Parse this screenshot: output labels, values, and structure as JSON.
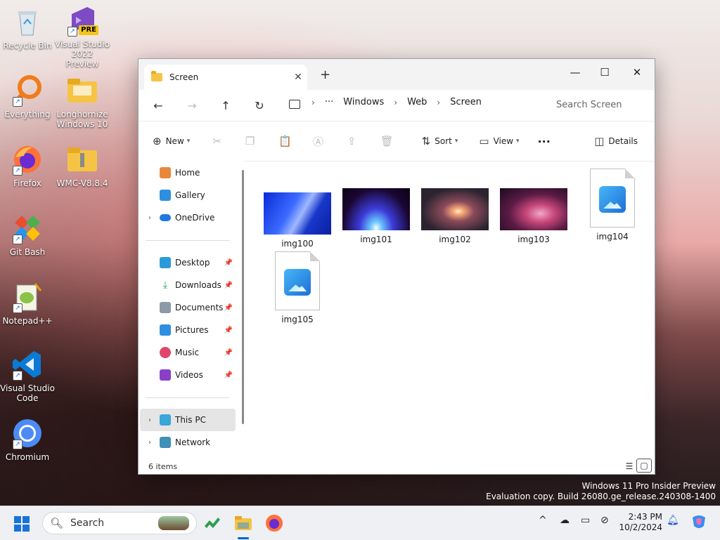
{
  "desktop": {
    "icons": [
      {
        "label": "Recycle Bin"
      },
      {
        "label": "Visual Studio 2022 Preview",
        "badge": "PRE"
      },
      {
        "label": "Everything"
      },
      {
        "label": "Longhornize Windows 10"
      },
      {
        "label": "Firefox"
      },
      {
        "label": "WMC-V8.8.4"
      },
      {
        "label": "Git Bash"
      },
      {
        "label": "Notepad++"
      },
      {
        "label": "Visual Studio Code"
      },
      {
        "label": "Chromium"
      }
    ]
  },
  "window": {
    "tab_title": "Screen",
    "breadcrumb": [
      "Windows",
      "Web",
      "Screen"
    ],
    "search_placeholder": "Search Screen",
    "toolbar": {
      "new_label": "New",
      "sort_label": "Sort",
      "view_label": "View",
      "details_label": "Details"
    },
    "sidebar": [
      {
        "label": "Home"
      },
      {
        "label": "Gallery"
      },
      {
        "label": "OneDrive"
      },
      {
        "label": "Desktop"
      },
      {
        "label": "Downloads"
      },
      {
        "label": "Documents"
      },
      {
        "label": "Pictures"
      },
      {
        "label": "Music"
      },
      {
        "label": "Videos"
      },
      {
        "label": "This PC"
      },
      {
        "label": "Network"
      }
    ],
    "files": [
      {
        "name": "img100"
      },
      {
        "name": "img101"
      },
      {
        "name": "img102"
      },
      {
        "name": "img103"
      },
      {
        "name": "img104"
      },
      {
        "name": "img105"
      }
    ],
    "status": "6 items"
  },
  "watermark": {
    "line1": "Windows 11 Pro Insider Preview",
    "line2": "Evaluation copy. Build 26080.ge_release.240308-1400"
  },
  "taskbar": {
    "search_label": "Search",
    "time": "2:43 PM",
    "date": "10/2/2024"
  },
  "colors": {
    "accent": "#0067c0",
    "folder": "#f6c445",
    "selected_nav": "#e5e5e5"
  }
}
